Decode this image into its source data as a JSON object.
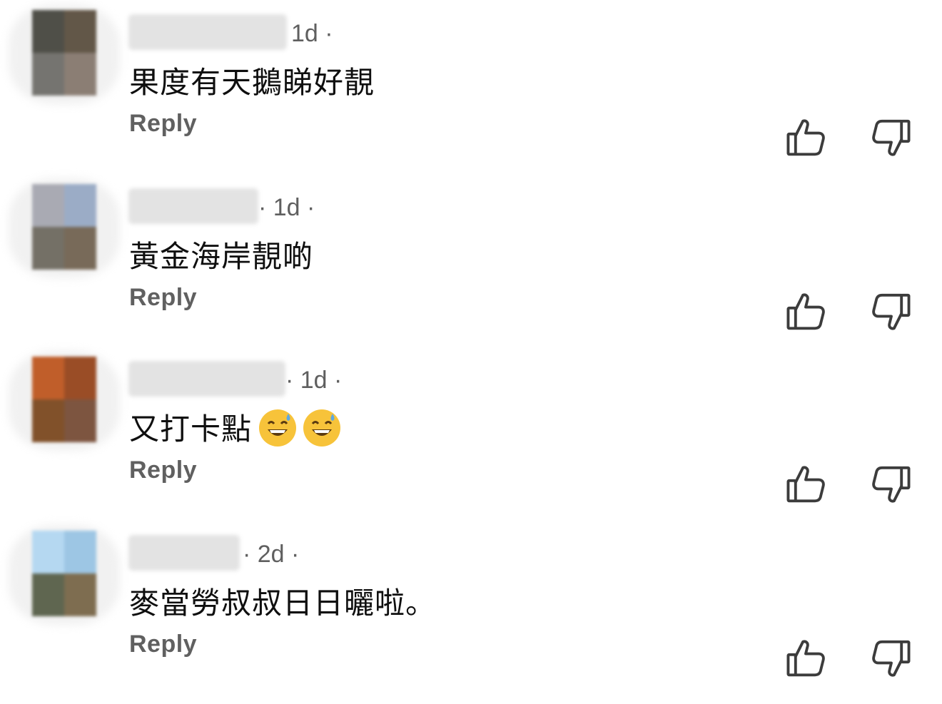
{
  "comments": [
    {
      "time": "1d ·",
      "text": "果度有天鵝睇好靚",
      "reply_label": "Reply",
      "avatar_colors": [
        "#4f4f48",
        "#625748",
        "#757470",
        "#8b7e74"
      ]
    },
    {
      "time": "· 1d ·",
      "text": "黃金海岸靚啲",
      "reply_label": "Reply",
      "avatar_colors": [
        "#a9aab3",
        "#9bacc6",
        "#747066",
        "#786a59"
      ]
    },
    {
      "time": "· 1d ·",
      "text": "又打卡點",
      "emoji": [
        "grinning-sweat-emoji",
        "grinning-sweat-emoji"
      ],
      "reply_label": "Reply",
      "avatar_colors": [
        "#c05e2a",
        "#9a4d26",
        "#81512a",
        "#7d5540"
      ]
    },
    {
      "time": "· 2d ·",
      "text": "麥當勞叔叔日日曬啦。",
      "reply_label": "Reply",
      "avatar_colors": [
        "#b5d8f1",
        "#9dc6e4",
        "#5f6650",
        "#7e6d50"
      ]
    }
  ],
  "icons": {
    "like": "thumbs-up-icon",
    "dislike": "thumbs-down-icon"
  },
  "colors": {
    "text": "#0f0f0f",
    "meta": "#5f5f5f",
    "reply": "#606060",
    "icon": "#3c3c3c"
  }
}
